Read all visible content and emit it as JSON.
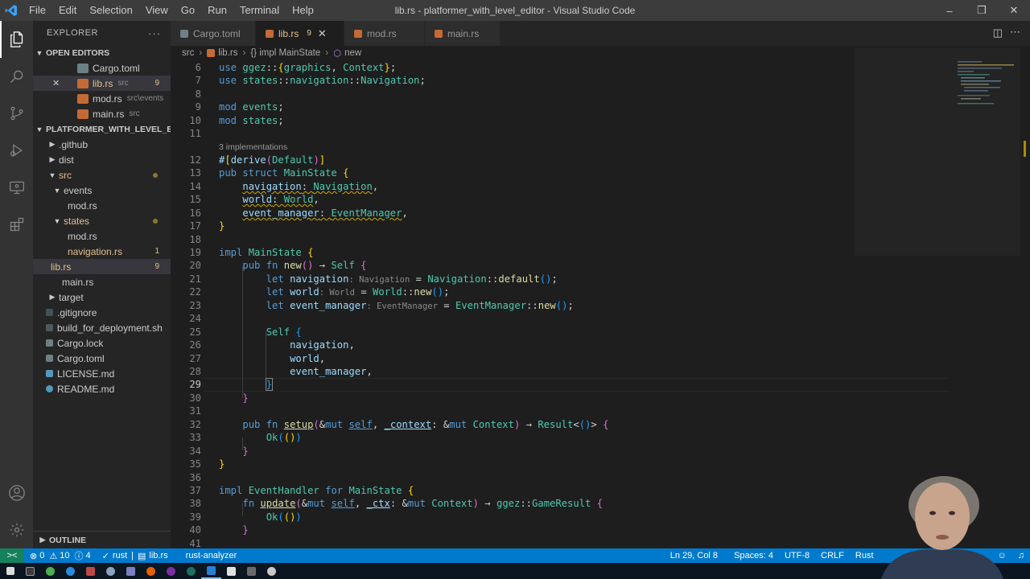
{
  "window": {
    "title": "lib.rs - platformer_with_level_editor - Visual Studio Code",
    "menu": [
      "File",
      "Edit",
      "Selection",
      "View",
      "Go",
      "Run",
      "Terminal",
      "Help"
    ]
  },
  "explorer": {
    "header": "EXPLORER",
    "more": "···",
    "open_editors_label": "OPEN EDITORS",
    "open_editors": [
      {
        "name": "Cargo.toml",
        "path": "",
        "badge": ""
      },
      {
        "name": "lib.rs",
        "path": "src",
        "badge": "9"
      },
      {
        "name": "mod.rs",
        "path": "src\\events",
        "badge": ""
      },
      {
        "name": "main.rs",
        "path": "src",
        "badge": ""
      }
    ],
    "project_label": "PLATFORMER_WITH_LEVEL_EDI...",
    "tree": [
      {
        "name": ".github",
        "badge": ""
      },
      {
        "name": "dist",
        "badge": ""
      },
      {
        "name": "src",
        "badge": ""
      },
      {
        "name": "events",
        "badge": ""
      },
      {
        "name": "mod.rs",
        "badge": ""
      },
      {
        "name": "states",
        "badge": ""
      },
      {
        "name": "mod.rs",
        "badge": ""
      },
      {
        "name": "navigation.rs",
        "badge": "1"
      },
      {
        "name": "lib.rs",
        "badge": "9"
      },
      {
        "name": "main.rs",
        "badge": ""
      },
      {
        "name": "target",
        "badge": ""
      },
      {
        "name": ".gitignore",
        "badge": ""
      },
      {
        "name": "build_for_deployment.sh",
        "badge": ""
      },
      {
        "name": "Cargo.lock",
        "badge": ""
      },
      {
        "name": "Cargo.toml",
        "badge": ""
      },
      {
        "name": "LICENSE.md",
        "badge": ""
      },
      {
        "name": "README.md",
        "badge": ""
      }
    ],
    "outline_label": "OUTLINE"
  },
  "tabs": [
    {
      "label": "Cargo.toml",
      "count": ""
    },
    {
      "label": "lib.rs",
      "count": "9"
    },
    {
      "label": "mod.rs",
      "count": ""
    },
    {
      "label": "main.rs",
      "count": ""
    }
  ],
  "breadcrumb": [
    "src",
    "lib.rs",
    "{} impl MainState",
    "new"
  ],
  "editor": {
    "codelens": "3 implementations",
    "line_numbers": [
      "6",
      "7",
      "8",
      "9",
      "10",
      "11",
      "12",
      "13",
      "14",
      "15",
      "16",
      "17",
      "18",
      "19",
      "20",
      "21",
      "22",
      "23",
      "24",
      "25",
      "26",
      "27",
      "28",
      "29",
      "30",
      "31",
      "32",
      "33",
      "34",
      "35",
      "36",
      "37",
      "38",
      "39",
      "40",
      "41"
    ]
  },
  "status": {
    "remote": "><",
    "errors": "0",
    "warnings": "10",
    "info": "4",
    "check": "rust",
    "file": "lib.rs",
    "analyzer": "rust-analyzer",
    "position": "Ln 29, Col 8",
    "spaces": "Spaces: 4",
    "encoding": "UTF-8",
    "eol": "CRLF",
    "language": "Rust"
  },
  "colors": {
    "statusbar": "#007acc",
    "accent_modified": "#e2c08d",
    "editor_bg": "#1e1e1e"
  }
}
